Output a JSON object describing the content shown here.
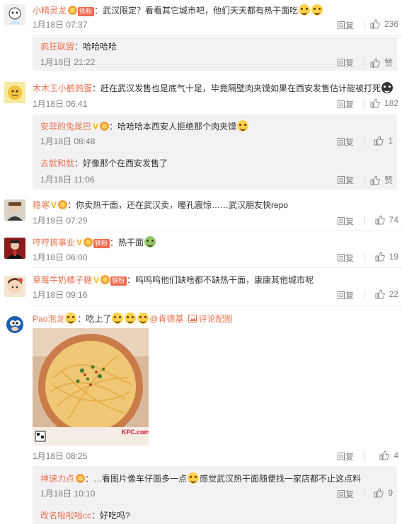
{
  "comments": [
    {
      "user": "小精灵龙",
      "fan_badge": "铁粉",
      "text": "：武汉限定？看看其它城市吧，他们天天都有热干面吃",
      "time": "1月18日 07:37",
      "reply": "回复",
      "likes": "236",
      "replies": [
        {
          "user": "疯狂联盟",
          "text": "：哈哈哈哈",
          "time": "1月18日 21:22",
          "reply": "回复",
          "likes": "赞"
        }
      ]
    },
    {
      "user": "木木王小鹤鹑蛋",
      "text": "：赶在武汉发售也是底气十足，毕竟隔壁肉夹馍如果在西安发售估计能被打死",
      "time": "1月18日 06:41",
      "reply": "回复",
      "likes": "182",
      "replies": [
        {
          "user": "安菲的兔尾巴",
          "text": "：哈哈哈本西安人拒绝那个肉夹馍",
          "time": "1月18日 08:48",
          "reply": "回复",
          "likes": "1"
        },
        {
          "user": "去就和就",
          "text": "：好像那个在西安发售了",
          "time": "1月18日 11:06",
          "reply": "回复",
          "likes": "赞"
        }
      ]
    },
    {
      "user": "稳寒",
      "text": "：你卖热干面，还在武汉卖，瞳孔震惊……武汉朋友快repo",
      "time": "1月18日 07:29",
      "reply": "回复",
      "likes": "74"
    },
    {
      "user": "哼哼搞事业",
      "fan_badge": "铁粉",
      "text": "：热干面",
      "time": "1月18日 06:00",
      "reply": "回复",
      "likes": "19"
    },
    {
      "user": "草莓牛奶橘子糖",
      "fan_badge": "铁粉",
      "text": "：呜呜呜他们缺啥都不缺热干面，康康其他城市呢",
      "time": "1月18日 09:16",
      "reply": "回复",
      "likes": "22"
    },
    {
      "user": "Pao泡龙",
      "text": "：吃上了",
      "mention": "@肯德基",
      "pic_link": "评论配图",
      "time": "1月18日 08:25",
      "reply": "回复",
      "likes": "4",
      "replies": [
        {
          "user": "神速力点",
          "text": "：…看图片像车仔面多一点",
          "text2": "感觉武汉热干面随便找一家店都不止这点料",
          "time": "1月18日 10:10",
          "reply": "回复",
          "likes": "9"
        },
        {
          "user": "改名啦啦啦cc",
          "text": "：好吃吗?"
        }
      ]
    }
  ],
  "photo_watermark": "KFC.com",
  "colors": {
    "username": "#eb7350",
    "meta": "#808080",
    "subbg": "#f2f2f5",
    "fan": "#f26a4f"
  },
  "icons": [
    "thumbs-up-icon",
    "image-icon",
    "vip-icon",
    "verified-v-icon",
    "emoji-icon"
  ]
}
